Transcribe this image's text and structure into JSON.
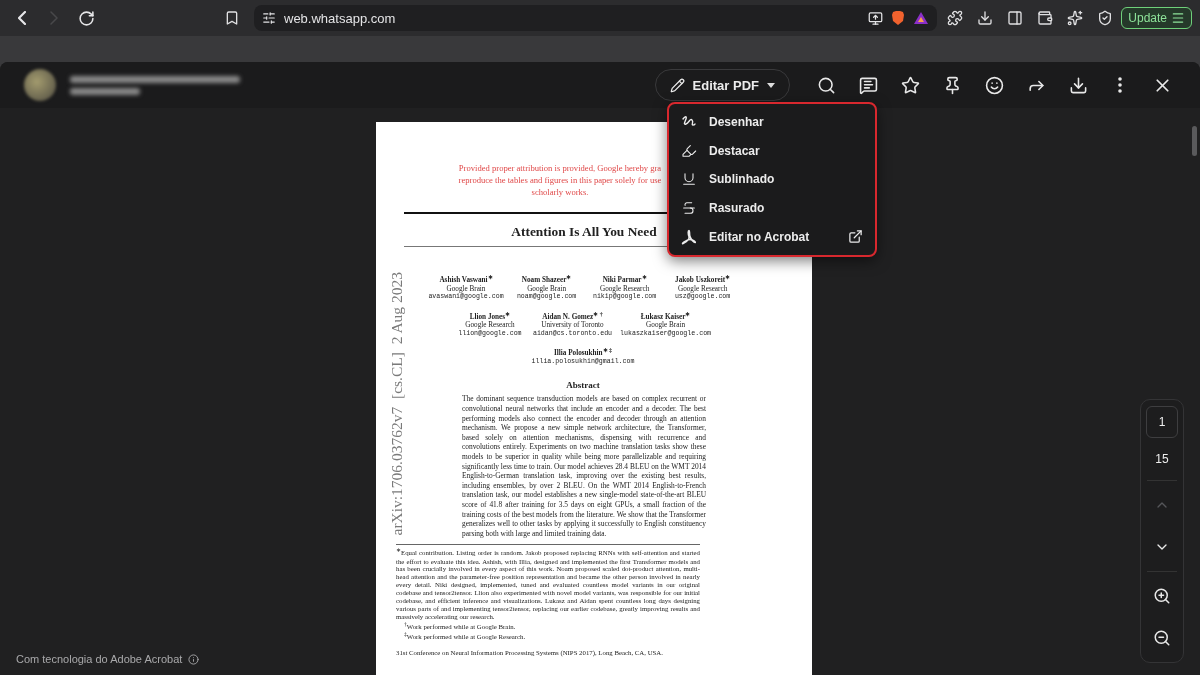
{
  "browser": {
    "nav_buttons": [
      {
        "kind": "back",
        "disabled": false
      },
      {
        "kind": "forward",
        "disabled": true
      },
      {
        "kind": "reload",
        "disabled": false
      }
    ],
    "url": "web.whatsapp.com",
    "update_label": "Update"
  },
  "viewer": {
    "edit_button": "Editar PDF",
    "menu": [
      {
        "kind": "draw",
        "label": "Desenhar"
      },
      {
        "kind": "highlight",
        "label": "Destacar"
      },
      {
        "kind": "underline",
        "label": "Sublinhado"
      },
      {
        "kind": "strike",
        "label": "Rasurado"
      },
      {
        "kind": "acrobat",
        "label": "Editar no Acrobat"
      }
    ],
    "page_nav": {
      "current": "1",
      "total": "15",
      "up_disabled": true,
      "down_disabled": false
    },
    "footer": "Com tecnologia do Adobe Acrobat"
  },
  "paper": {
    "stamp": "arXiv:1706.03762v7  [cs.CL]  2 Aug 2023",
    "notice": [
      "Provided proper attribution is provided, Google hereby gra",
      "reproduce the tables and figures in this paper solely for use",
      "scholarly works."
    ],
    "title": "Attention Is All You Need",
    "author_rows": [
      [
        {
          "name": "Ashish Vaswani$^{∗}$",
          "affiliation": "Google Brain",
          "email": "avaswani@google.com"
        },
        {
          "name": "Noam Shazeer$^{∗}$",
          "affiliation": "Google Brain",
          "email": "noam@google.com"
        },
        {
          "name": "Niki Parmar$^{∗}$",
          "affiliation": "Google Research",
          "email": "nikip@google.com"
        },
        {
          "name": "Jakob Uszkoreit$^{∗}$",
          "affiliation": "Google Research",
          "email": "usz@google.com"
        }
      ],
      [
        {
          "name": "Llion Jones$^{∗}$",
          "affiliation": "Google Research",
          "email": "llion@google.com"
        },
        {
          "name": "Aidan N. Gomez$^{∗ †}$",
          "affiliation": "University of Toronto",
          "email": "aidan@cs.toronto.edu"
        },
        {
          "name": "Łukasz Kaiser$^{∗}$",
          "affiliation": "Google Brain",
          "email": "lukaszkaiser@google.com"
        }
      ],
      [
        {
          "name": "Illia Polosukhin$^{∗ ‡}$",
          "email": "illia.polosukhin@gmail.com"
        }
      ]
    ],
    "abstract_heading": "Abstract",
    "abstract": "The dominant sequence transduction models are based on complex recurrent or convolutional neural networks that include an encoder and a decoder. The best performing models also connect the encoder and decoder through an attention mechanism. We propose a new simple network architecture, the Transformer, based solely on attention mechanisms, dispensing with recurrence and convolutions entirely. Experiments on two machine translation tasks show these models to be superior in quality while being more parallelizable and requiring significantly less time to train. Our model achieves 28.4 BLEU on the WMT 2014 English-to-German translation task, improving over the existing best results, including ensembles, by over 2 BLEU. On the WMT 2014 English-to-French translation task, our model establishes a new single-model state-of-the-art BLEU score of 41.8 after training for 3.5 days on eight GPUs, a small fraction of the training costs of the best models from the literature. We show that the Transformer generalizes well to other tasks by applying it successfully to English constituency parsing both with large and limited training data.",
    "footnotes": [
      "$^{∗}$Equal contribution. Listing order is random. Jakob proposed replacing RNNs with self-attention and started the effort to evaluate this idea. Ashish, with Illia, designed and implemented the first Transformer models and has been crucially involved in every aspect of this work. Noam proposed scaled dot-product attention, multi-head attention and the parameter-free position representation and became the other person involved in nearly every detail. Niki designed, implemented, tuned and evaluated countless model variants in our original codebase and tensor2tensor. Llion also experimented with novel model variants, was responsible for our initial codebase, and efficient inference and visualizations. Lukasz and Aidan spent countless long days designing various parts of and implementing tensor2tensor, replacing our earlier codebase, greatly improving results and massively accelerating our research.",
      "$^{†}$Work performed while at Google Brain.",
      "$^{‡}$Work performed while at Google Research."
    ],
    "conference": "31st Conference on Neural Information Processing Systems (NIPS 2017), Long Beach, CA, USA."
  }
}
